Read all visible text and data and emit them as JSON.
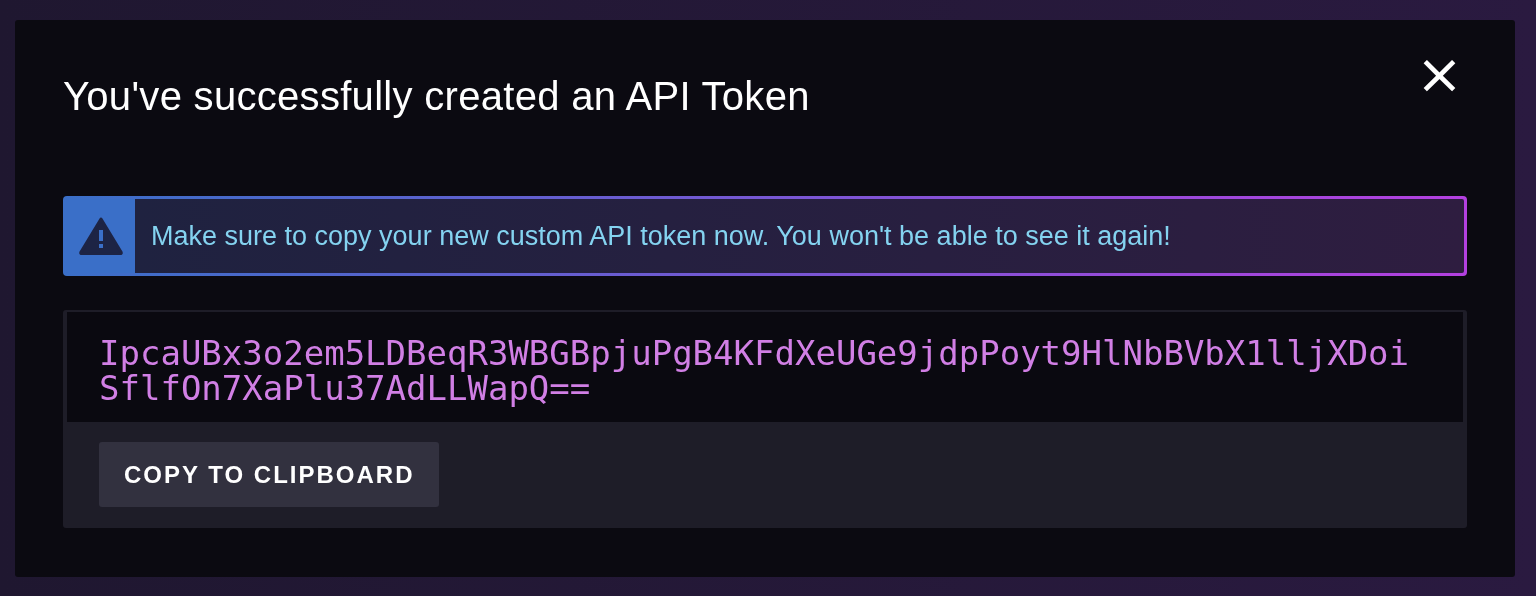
{
  "dialog": {
    "title": "You've successfully created an API Token",
    "close": "×"
  },
  "alert": {
    "kind": "warning",
    "message": "Make sure to copy your new custom API token now. You won't be able to see it again!"
  },
  "token": {
    "value": "IpcaUBx3o2em5LDBeqR3WBGBpjuPgB4KFdXeUGe9jdpPoyt9HlNbBVbX1lljXDoiSflfOn7XaPlu37AdLLWapQ=="
  },
  "buttons": [
    {
      "label": "COPY TO CLIPBOARD"
    }
  ]
}
